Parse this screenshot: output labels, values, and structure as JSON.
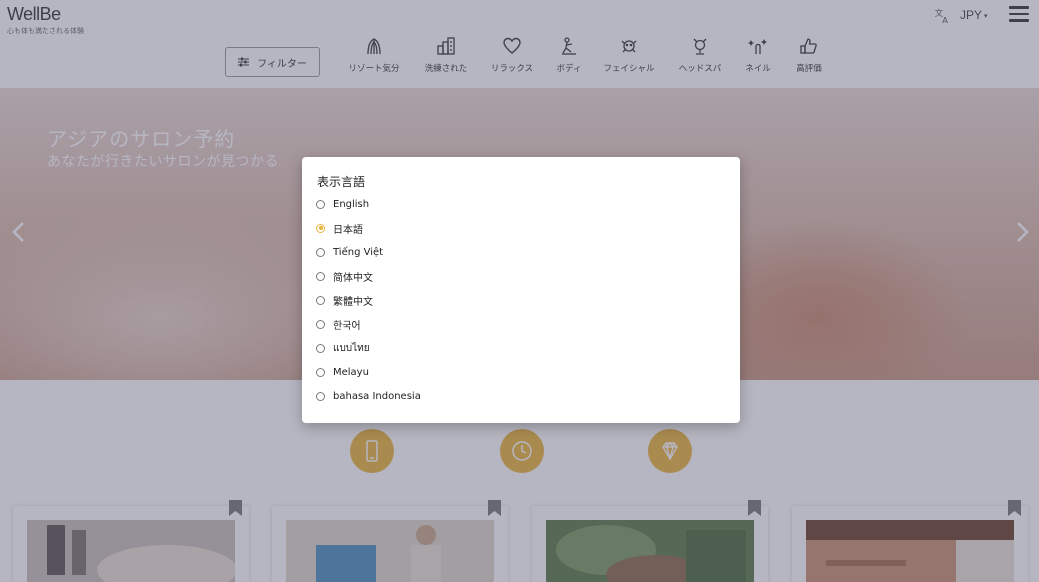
{
  "header": {
    "logo": "WellBe",
    "tagline": "心も体も満たされる体験",
    "currency": "JPY",
    "filter_label": "フィルター"
  },
  "categories": [
    {
      "label": "リゾート気分",
      "icon": "resort-icon"
    },
    {
      "label": "洗練された",
      "icon": "building-icon"
    },
    {
      "label": "リラックス",
      "icon": "heart-icon"
    },
    {
      "label": "ボディ",
      "icon": "body-massage-icon"
    },
    {
      "label": "フェイシャル",
      "icon": "facial-icon"
    },
    {
      "label": "ヘッドスパ",
      "icon": "head-spa-icon"
    },
    {
      "label": "ネイル",
      "icon": "nail-icon"
    },
    {
      "label": "高評価",
      "icon": "thumbs-up-icon"
    }
  ],
  "hero": {
    "title": "アジアのサロン予約",
    "subtitle": "あなたが行きたいサロンが見つかる"
  },
  "features": [
    {
      "icon": "smartphone-icon"
    },
    {
      "icon": "clock-icon"
    },
    {
      "icon": "diamond-icon"
    }
  ],
  "dialog": {
    "title": "表示言語",
    "selected": "日本語",
    "options": [
      "English",
      "日本語",
      "Tiếng Việt",
      "简体中文",
      "繁體中文",
      "한국어",
      "แบบไทย",
      "Melayu",
      "bahasa Indonesia"
    ]
  },
  "colors": {
    "accent": "#e8b53a",
    "overlay": "#50506e"
  }
}
